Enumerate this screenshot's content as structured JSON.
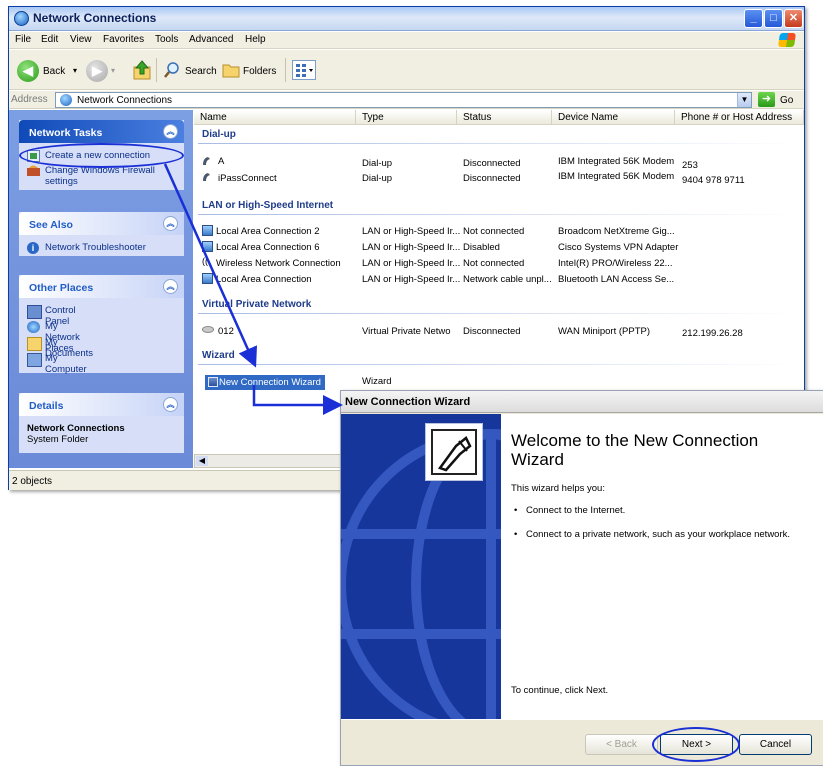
{
  "window": {
    "title": "Network Connections",
    "menu": [
      "File",
      "Edit",
      "View",
      "Favorites",
      "Tools",
      "Advanced",
      "Help"
    ],
    "toolbar": {
      "back_label": "Back",
      "search_label": "Search",
      "folders_label": "Folders"
    },
    "address": {
      "label": "Address",
      "value": "Network Connections",
      "go_label": "Go"
    },
    "status": "2 objects"
  },
  "taskpane": {
    "network_tasks": {
      "title": "Network Tasks",
      "items": [
        "Create a new connection",
        "Change Windows Firewall settings"
      ]
    },
    "see_also": {
      "title": "See Also",
      "items": [
        "Network Troubleshooter"
      ]
    },
    "other_places": {
      "title": "Other Places",
      "items": [
        "Control Panel",
        "My Network Places",
        "My Documents",
        "My Computer"
      ]
    },
    "details": {
      "title": "Details",
      "name": "Network Connections",
      "subtitle": "System Folder"
    }
  },
  "list": {
    "columns": [
      "Name",
      "Type",
      "Status",
      "Device Name",
      "Phone # or Host Address"
    ],
    "groups": [
      {
        "title": "Dial-up",
        "rows": [
          [
            "A",
            "Dial-up",
            "Disconnected",
            "IBM Integrated 56K Modem",
            "253"
          ],
          [
            "iPassConnect",
            "Dial-up",
            "Disconnected",
            "IBM Integrated 56K Modem",
            "9404 978 9711"
          ]
        ]
      },
      {
        "title": "LAN or High-Speed Internet",
        "rows": [
          [
            "Local Area Connection 2",
            "LAN or High-Speed Ir...",
            "Not connected",
            "Broadcom NetXtreme Gig...",
            ""
          ],
          [
            "Local Area Connection 6",
            "LAN or High-Speed Ir...",
            "Disabled",
            "Cisco Systems VPN Adapter",
            ""
          ],
          [
            "Wireless Network Connection",
            "LAN or High-Speed Ir...",
            "Not connected",
            "Intel(R) PRO/Wireless 22...",
            ""
          ],
          [
            "Local Area Connection",
            "LAN or High-Speed Ir...",
            "Network cable unpl...",
            "Bluetooth LAN Access Se...",
            ""
          ]
        ]
      },
      {
        "title": "Virtual Private Network",
        "rows": [
          [
            "012",
            "Virtual Private Netwo",
            "Disconnected",
            "WAN Miniport (PPTP)",
            "212.199.26.28"
          ]
        ]
      },
      {
        "title": "Wizard",
        "rows": [
          [
            "New Connection Wizard",
            "Wizard",
            "",
            "",
            ""
          ]
        ]
      }
    ]
  },
  "wizard": {
    "title": "New Connection Wizard",
    "heading": "Welcome to the New Connection Wizard",
    "intro": "This wizard helps you:",
    "bullets": [
      "Connect to the Internet.",
      "Connect to a private network, such as your workplace network."
    ],
    "continue": "To continue, click Next.",
    "buttons": {
      "back": "< Back",
      "next": "Next >",
      "cancel": "Cancel"
    }
  },
  "colors": {
    "highlight": "#1a2fd6",
    "selection": "#316ac5",
    "banner": "#16369c"
  }
}
